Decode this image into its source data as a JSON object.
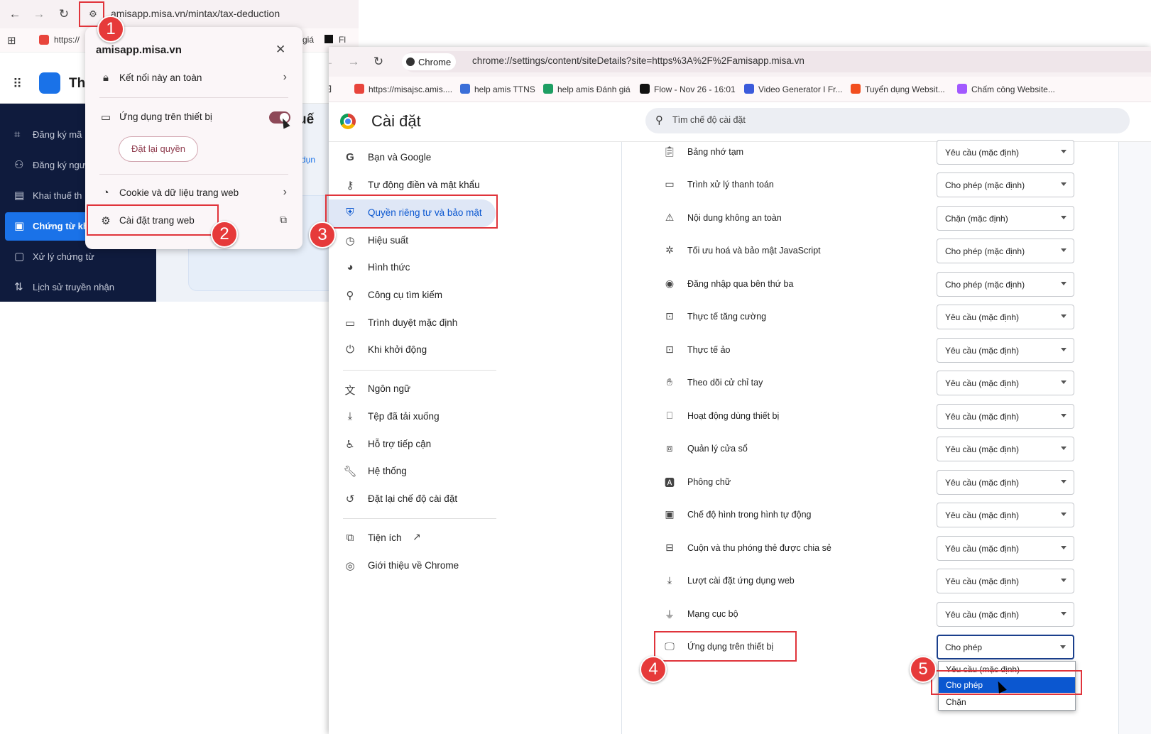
{
  "back_window": {
    "url": "amisapp.misa.vn/mintax/tax-deduction",
    "bookmarks": [
      "https://",
      "giá",
      "Fl"
    ],
    "app_title_partial": "Th",
    "content_partial": "uế",
    "content_tab_partial": "dụn",
    "sidebar": [
      {
        "label": "Đăng ký mã",
        "icon": "scan-icon"
      },
      {
        "label": "Đăng ký ngư",
        "icon": "users-icon"
      },
      {
        "label": "Khai thuế th",
        "icon": "document-icon"
      },
      {
        "label": "Chứng từ kh",
        "icon": "receipt-icon",
        "active": true
      },
      {
        "label": "Xử lý chứng từ",
        "icon": "file-check-icon"
      },
      {
        "label": "Lịch sử truyền nhận",
        "icon": "transfer-icon"
      }
    ]
  },
  "popup": {
    "domain": "amisapp.misa.vn",
    "secure_label": "Kết nối này an toàn",
    "device_apps_label": "Ứng dụng trên thiết bị",
    "reset_label": "Đặt lại quyền",
    "cookies_label": "Cookie và dữ liệu trang web",
    "site_settings_label": "Cài đặt trang web"
  },
  "front_window": {
    "chip": "Chrome",
    "url": "chrome://settings/content/siteDetails?site=https%3A%2F%2Famisapp.misa.vn",
    "bookmarks": [
      {
        "label": "https://misajsc.amis....",
        "color": "#e8453c"
      },
      {
        "label": "help amis TTNS",
        "color": "#3b6fd8"
      },
      {
        "label": "help amis Đánh giá",
        "color": "#1e9e63"
      },
      {
        "label": "Flow - Nov 26 - 16:01",
        "color": "#111111"
      },
      {
        "label": "Video Generator I Fr...",
        "color": "#3b5bdb"
      },
      {
        "label": "Tuyển dụng Websit...",
        "color": "#f24e1e"
      },
      {
        "label": "Chấm công Website...",
        "color": "#a259ff"
      }
    ],
    "title": "Cài đặt",
    "search_placeholder": "Tìm chế độ cài đặt",
    "nav_group1": [
      {
        "label": "Bạn và Google",
        "icon": "google-icon"
      },
      {
        "label": "Tự động điền và mật khẩu",
        "icon": "key-icon"
      },
      {
        "label": "Quyền riêng tư và bảo mật",
        "icon": "shield-icon",
        "active": true
      },
      {
        "label": "Hiệu suất",
        "icon": "speed-icon"
      },
      {
        "label": "Hình thức",
        "icon": "palette-icon"
      },
      {
        "label": "Công cụ tìm kiếm",
        "icon": "search-icon"
      },
      {
        "label": "Trình duyệt mặc định",
        "icon": "browser-icon"
      },
      {
        "label": "Khi khởi động",
        "icon": "power-icon"
      }
    ],
    "nav_group2": [
      {
        "label": "Ngôn ngữ",
        "icon": "translate-icon"
      },
      {
        "label": "Tệp đã tải xuống",
        "icon": "download-icon"
      },
      {
        "label": "Hỗ trợ tiếp cận",
        "icon": "accessibility-icon"
      },
      {
        "label": "Hệ thống",
        "icon": "wrench-icon"
      },
      {
        "label": "Đặt lại chế độ cài đặt",
        "icon": "reset-icon"
      }
    ],
    "nav_group3": [
      {
        "label": "Tiện ích",
        "icon": "puzzle-icon"
      },
      {
        "label": "Giới thiệu về Chrome",
        "icon": "chrome-icon"
      }
    ],
    "permissions": [
      {
        "label": "Bảng nhớ tạm",
        "value": "Yêu cầu (mặc định)",
        "icon": "clipboard-icon"
      },
      {
        "label": "Trình xử lý thanh toán",
        "value": "Cho phép (mặc định)",
        "icon": "card-icon"
      },
      {
        "label": "Nội dung không an toàn",
        "value": "Chặn (mặc định)",
        "icon": "warning-icon"
      },
      {
        "label": "Tối ưu hoá và bảo mật JavaScript",
        "value": "Cho phép (mặc định)",
        "icon": "js-icon"
      },
      {
        "label": "Đăng nhập qua bên thứ ba",
        "value": "Cho phép (mặc định)",
        "icon": "account-icon"
      },
      {
        "label": "Thực tế tăng cường",
        "value": "Yêu cầu (mặc định)",
        "icon": "ar-icon"
      },
      {
        "label": "Thực tế ảo",
        "value": "Yêu cầu (mặc định)",
        "icon": "vr-icon"
      },
      {
        "label": "Theo dõi cử chỉ tay",
        "value": "Yêu cầu (mặc định)",
        "icon": "hand-icon"
      },
      {
        "label": "Hoạt động dùng thiết bị",
        "value": "Yêu cầu (mặc định)",
        "icon": "devices-icon"
      },
      {
        "label": "Quản lý cửa sổ",
        "value": "Yêu cầu (mặc định)",
        "icon": "windows-icon"
      },
      {
        "label": "Phông chữ",
        "value": "Yêu cầu (mặc định)",
        "icon": "font-icon"
      },
      {
        "label": "Chế độ hình trong hình tự động",
        "value": "Yêu cầu (mặc định)",
        "icon": "pip-icon"
      },
      {
        "label": "Cuộn và thu phóng thẻ được chia sẻ",
        "value": "Yêu cầu (mặc định)",
        "icon": "scroll-zoom-icon"
      },
      {
        "label": "Lượt cài đặt ứng dụng web",
        "value": "Yêu cầu (mặc định)",
        "icon": "install-icon"
      },
      {
        "label": "Mạng cục bộ",
        "value": "Yêu cầu (mặc định)",
        "icon": "router-icon"
      },
      {
        "label": "Ứng dụng trên thiết bị",
        "value": "Cho phép",
        "icon": "monitor-icon"
      }
    ],
    "dropdown_options": [
      "Yêu cầu (mặc định)",
      "Cho phép",
      "Chặn"
    ]
  },
  "badges": [
    "1",
    "2",
    "3",
    "4",
    "5"
  ],
  "colors": {
    "annotation_red": "#e0343b",
    "accent_blue": "#0b57d0",
    "sidebar_dark": "#0f1b3d"
  }
}
